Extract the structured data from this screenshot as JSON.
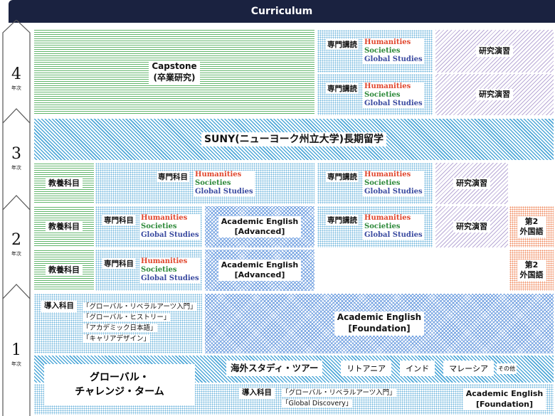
{
  "header": {
    "title": "Curriculum"
  },
  "years": [
    {
      "num": "4",
      "sub": "年次"
    },
    {
      "num": "3",
      "sub": "年次"
    },
    {
      "num": "2",
      "sub": "年次"
    },
    {
      "num": "1",
      "sub": "年次"
    }
  ],
  "subjects": {
    "humanities": "Humanities",
    "societies": "Societies",
    "global": "Global Studies"
  },
  "labels": {
    "senmon_kogi": "専門講読",
    "senmon_kamoku": "専門科目",
    "kenkyu": "研究演習",
    "kyoyo": "教養科目",
    "dai2": "第2",
    "gaikokugo": "外国語",
    "acad_adv_1": "Academic English",
    "acad_adv_2": "[Advanced]"
  },
  "year4": {
    "capstone_1": "Capstone",
    "capstone_2": "(卒業研究)"
  },
  "year3": {
    "suny": "SUNY(ニューヨーク州立大学)長期留学"
  },
  "year1": {
    "donyu": "導入科目",
    "courses": [
      "「グローバル・リベラルアーツ入門」",
      "「グローバル・ヒストリー」",
      "「アカデミック日本語」",
      "「キャリアデザイン」"
    ],
    "acad_found_1": "Academic English",
    "acad_found_2": "[Foundation]",
    "challenge_1": "グローバル・",
    "challenge_2": "チャレンジ・ターム",
    "kaigai": "海外スタディ・ツアー",
    "tour_1": "リトアニア",
    "tour_2": "インド",
    "tour_3": "マレーシア",
    "tour_other": "その他",
    "donyu2": "導入科目",
    "course2_1": "「グローバル・リベラルアーツ入門」",
    "course2_2": "「Global Discovery」",
    "acad2_1": "Academic English",
    "acad2_2": "[Foundation]"
  },
  "colors": {
    "navy": "#1a2240",
    "green": "#61b56b",
    "blue": "#4fa8d8",
    "purple": "#b8a9d6",
    "orange": "#f08a5d"
  }
}
